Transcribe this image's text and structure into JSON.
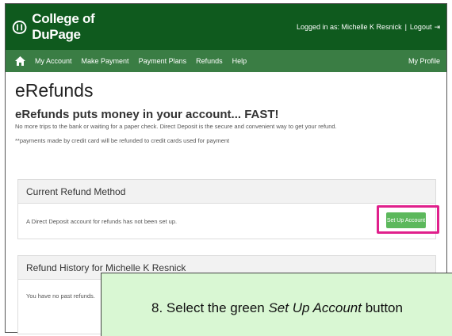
{
  "header": {
    "logo_text": "College of DuPage",
    "logged_in_text": "Logged in as: Michelle K Resnick",
    "separator": "|",
    "logout_label": "Logout"
  },
  "nav": {
    "items": [
      {
        "label": "My Account"
      },
      {
        "label": "Make Payment"
      },
      {
        "label": "Payment Plans"
      },
      {
        "label": "Refunds"
      },
      {
        "label": "Help"
      }
    ],
    "profile_label": "My Profile"
  },
  "page": {
    "title": "eRefunds",
    "tagline": "eRefunds puts money in your account... FAST!",
    "description": "No more trips to the bank or waiting for a paper check. Direct Deposit is the secure and convenient way to get your refund.",
    "note": "**payments made by credit card will be refunded to credit cards used for payment"
  },
  "current_refund": {
    "heading": "Current Refund Method",
    "message": "A Direct Deposit account for refunds has not been set up.",
    "button_label": "Set Up Account"
  },
  "history": {
    "heading": "Refund History for Michelle K Resnick",
    "message": "You have no past refunds."
  },
  "callout": {
    "prefix": "8. Select the green ",
    "emphasis": "Set Up Account",
    "suffix": " button"
  },
  "colors": {
    "header_green": "#0f5a1e",
    "nav_green": "#3a7d44",
    "button_green": "#5cb85c",
    "highlight_pink": "#e0208c",
    "callout_bg": "#d9f7d3"
  },
  "icons": {
    "logo": "college-logo-icon",
    "home": "home-icon",
    "logout": "logout-icon"
  }
}
